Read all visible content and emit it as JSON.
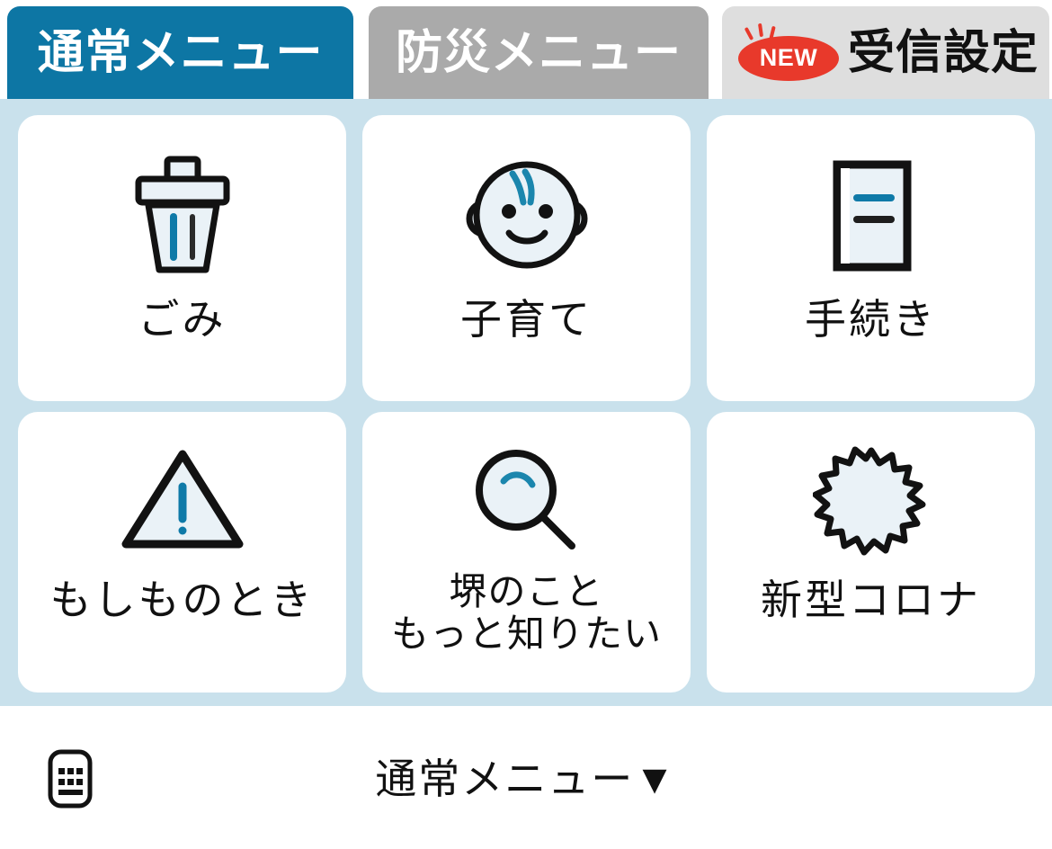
{
  "tabs": [
    {
      "label": "通常メニュー",
      "state": "active",
      "color": "#0d76a4",
      "name": "tab-normal-menu"
    },
    {
      "label": "防災メニュー",
      "state": "inactive",
      "color": "#aaaaaa",
      "name": "tab-disaster-menu"
    },
    {
      "label": "受信設定",
      "state": "inactive",
      "color": "#dedede",
      "badge": "NEW",
      "badge_color": "#e8392b",
      "name": "tab-receive-settings"
    }
  ],
  "grid": {
    "background_color": "#c9e1ec",
    "tiles": [
      {
        "label": "ごみ",
        "icon": "trash-bin-icon"
      },
      {
        "label": "子育て",
        "icon": "baby-face-icon"
      },
      {
        "label": "手続き",
        "icon": "document-icon"
      },
      {
        "label": "もしものとき",
        "icon": "warning-triangle-icon"
      },
      {
        "label": "堺のこと\nもっと知りたい",
        "icon": "magnifier-icon"
      },
      {
        "label": "新型コロナ",
        "icon": "virus-icon"
      }
    ]
  },
  "bottom_bar": {
    "keyboard_icon": "keyboard-icon",
    "menu_toggle_label": "通常メニュー",
    "menu_toggle_caret": "▼"
  },
  "colors": {
    "accent_blue": "#0f7aa8",
    "icon_fill": "#eaf2f7",
    "outline": "#121212",
    "badge_red": "#e8392b",
    "panel_blue": "#c9e1ec"
  }
}
